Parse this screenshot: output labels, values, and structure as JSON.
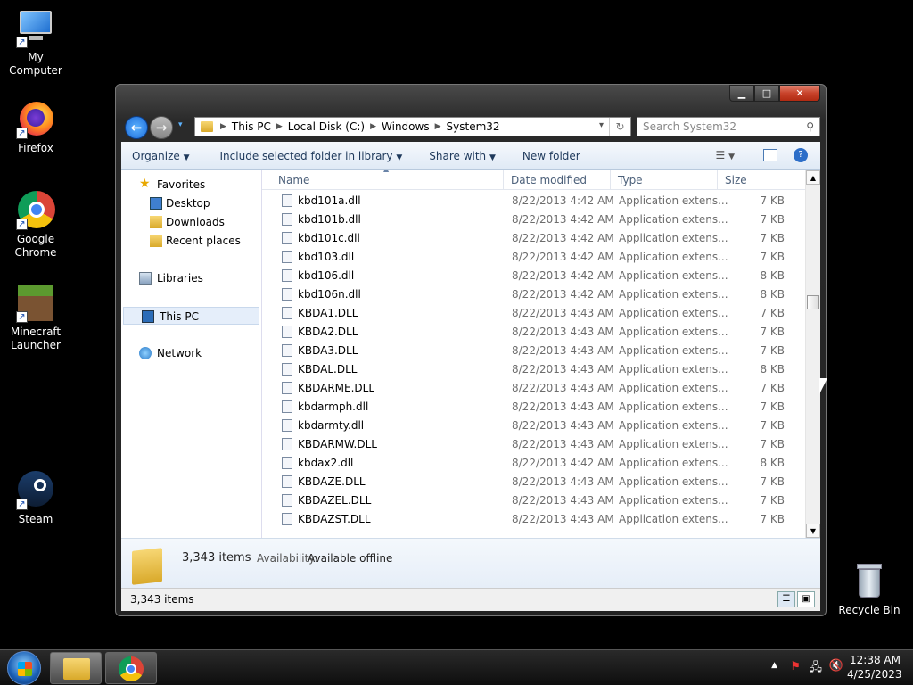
{
  "desktop": {
    "icons": [
      {
        "label": "My Computer"
      },
      {
        "label": "Firefox"
      },
      {
        "label": "Google Chrome"
      },
      {
        "label": "Minecraft Launcher"
      },
      {
        "label": "Steam"
      },
      {
        "label": "Recycle Bin"
      }
    ]
  },
  "explorer": {
    "breadcrumb": [
      "This PC",
      "Local Disk (C:)",
      "Windows",
      "System32"
    ],
    "search_placeholder": "Search System32",
    "toolbar": {
      "organize": "Organize",
      "include": "Include selected folder in library",
      "share": "Share with",
      "new_folder": "New folder"
    },
    "nav": {
      "favorites": "Favorites",
      "desktop": "Desktop",
      "downloads": "Downloads",
      "recent": "Recent places",
      "libraries": "Libraries",
      "this_pc": "This PC",
      "network": "Network"
    },
    "columns": {
      "name": "Name",
      "date": "Date modified",
      "type": "Type",
      "size": "Size"
    },
    "files": [
      {
        "name": "kbd101a.dll",
        "date": "8/22/2013 4:42 AM",
        "type": "Application extens...",
        "size": "7 KB"
      },
      {
        "name": "kbd101b.dll",
        "date": "8/22/2013 4:42 AM",
        "type": "Application extens...",
        "size": "7 KB"
      },
      {
        "name": "kbd101c.dll",
        "date": "8/22/2013 4:42 AM",
        "type": "Application extens...",
        "size": "7 KB"
      },
      {
        "name": "kbd103.dll",
        "date": "8/22/2013 4:42 AM",
        "type": "Application extens...",
        "size": "7 KB"
      },
      {
        "name": "kbd106.dll",
        "date": "8/22/2013 4:42 AM",
        "type": "Application extens...",
        "size": "8 KB"
      },
      {
        "name": "kbd106n.dll",
        "date": "8/22/2013 4:42 AM",
        "type": "Application extens...",
        "size": "8 KB"
      },
      {
        "name": "KBDA1.DLL",
        "date": "8/22/2013 4:43 AM",
        "type": "Application extens...",
        "size": "7 KB"
      },
      {
        "name": "KBDA2.DLL",
        "date": "8/22/2013 4:43 AM",
        "type": "Application extens...",
        "size": "7 KB"
      },
      {
        "name": "KBDA3.DLL",
        "date": "8/22/2013 4:43 AM",
        "type": "Application extens...",
        "size": "7 KB"
      },
      {
        "name": "KBDAL.DLL",
        "date": "8/22/2013 4:43 AM",
        "type": "Application extens...",
        "size": "8 KB"
      },
      {
        "name": "KBDARME.DLL",
        "date": "8/22/2013 4:43 AM",
        "type": "Application extens...",
        "size": "7 KB"
      },
      {
        "name": "kbdarmph.dll",
        "date": "8/22/2013 4:43 AM",
        "type": "Application extens...",
        "size": "7 KB"
      },
      {
        "name": "kbdarmty.dll",
        "date": "8/22/2013 4:43 AM",
        "type": "Application extens...",
        "size": "7 KB"
      },
      {
        "name": "KBDARMW.DLL",
        "date": "8/22/2013 4:43 AM",
        "type": "Application extens...",
        "size": "7 KB"
      },
      {
        "name": "kbdax2.dll",
        "date": "8/22/2013 4:42 AM",
        "type": "Application extens...",
        "size": "8 KB"
      },
      {
        "name": "KBDAZE.DLL",
        "date": "8/22/2013 4:43 AM",
        "type": "Application extens...",
        "size": "7 KB"
      },
      {
        "name": "KBDAZEL.DLL",
        "date": "8/22/2013 4:43 AM",
        "type": "Application extens...",
        "size": "7 KB"
      },
      {
        "name": "KBDAZST.DLL",
        "date": "8/22/2013 4:43 AM",
        "type": "Application extens...",
        "size": "7 KB"
      }
    ],
    "details": {
      "count": "3,343 items",
      "availability_label": "Availability:",
      "availability_value": "Available offline"
    },
    "status": {
      "count": "3,343 items"
    }
  },
  "taskbar": {
    "time": "12:38 AM",
    "date": "4/25/2023"
  }
}
